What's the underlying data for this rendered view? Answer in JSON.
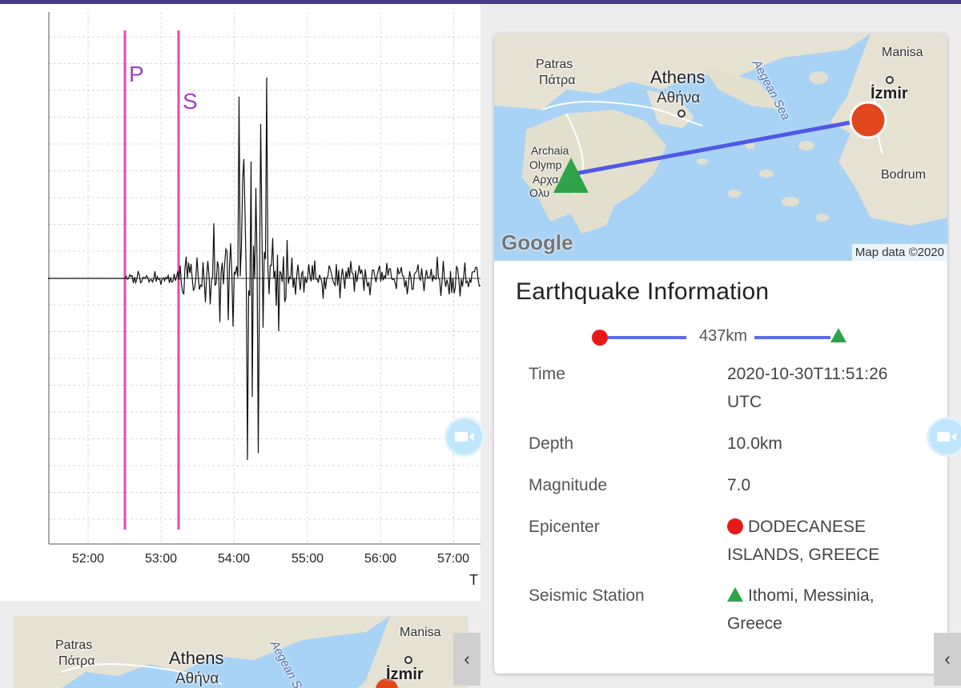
{
  "seismogram": {
    "x_ticks": [
      "52:00",
      "53:00",
      "54:00",
      "55:00",
      "56:00",
      "57:00"
    ],
    "axis_cut_label": "T",
    "phase_p": "P",
    "phase_s": "S"
  },
  "map": {
    "labels": {
      "patras_en": "Patras",
      "patras_gr": "Πάτρα",
      "athens_en": "Athens",
      "athens_gr": "Αθήνα",
      "manisa": "Manisa",
      "izmir": "İzmir",
      "bodrum": "Bodrum",
      "archaia1": "Archaia",
      "archaia2": "Olymp",
      "archaia3": "Αρχα",
      "archaia4": "Ολυ",
      "sea": "Aegean Sea"
    },
    "google_logo": "Google",
    "attribution": "Map data ©2020"
  },
  "mini_map": {
    "patras_en": "Patras",
    "patras_gr": "Πάτρα",
    "athens_en": "Athens",
    "athens_gr": "Αθήνα",
    "manisa": "Manisa",
    "izmir": "İzmir",
    "sea": "Aegean S"
  },
  "info": {
    "title": "Earthquake Information",
    "distance": "437km",
    "time_label": "Time",
    "time_value": "2020-10-30T11:51:26 UTC",
    "depth_label": "Depth",
    "depth_value": "10.0km",
    "magnitude_label": "Magnitude",
    "magnitude_value": "7.0",
    "epicenter_label": "Epicenter",
    "epicenter_value": "DODECANESE ISLANDS, GREECE",
    "station_label": "Seismic Station",
    "station_value": "Ithomi, Messinia, Greece"
  },
  "icons": {
    "camera": "video-camera-icon",
    "chevron": "‹"
  },
  "colors": {
    "top_bar": "#4a3b8c",
    "phase_lines": "#e04ab8",
    "epicenter": "#e81919",
    "station": "#2fa34a",
    "route": "#5b6ee6"
  }
}
